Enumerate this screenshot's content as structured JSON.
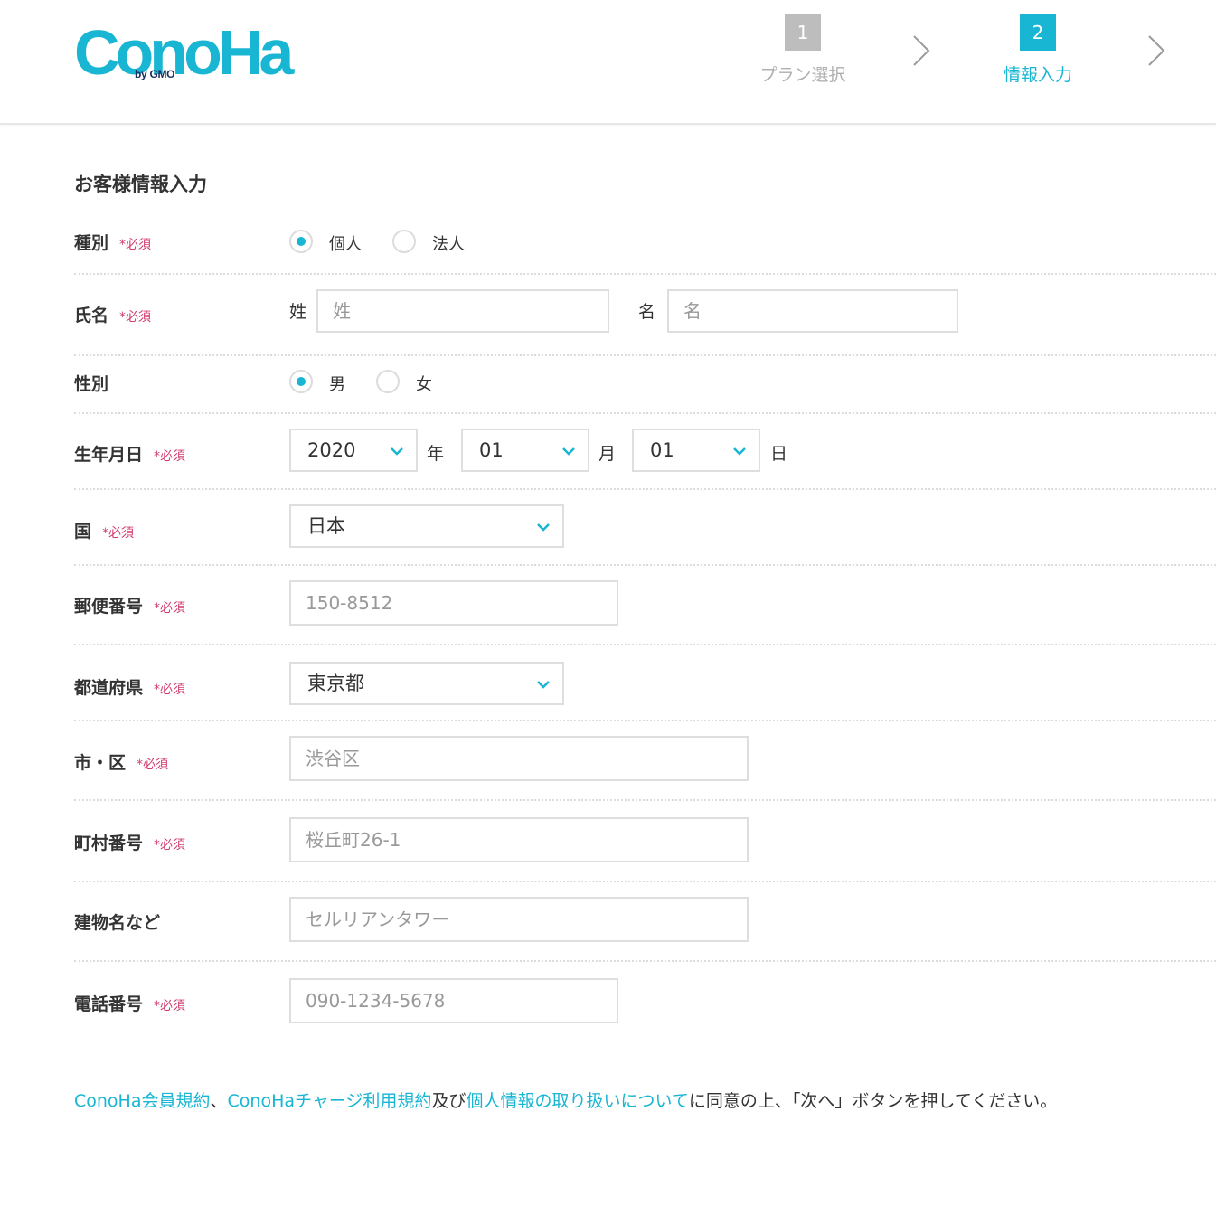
{
  "header": {
    "logo_text": "ConoHa",
    "logo_sub": "by GMO",
    "steps": [
      {
        "number": "1",
        "label": "プラン選択"
      },
      {
        "number": "2",
        "label": "情報入力"
      }
    ]
  },
  "form": {
    "title": "お客様情報入力",
    "required_mark": "*必須",
    "type": {
      "label": "種別",
      "options": [
        "個人",
        "法人"
      ],
      "selected": "個人"
    },
    "name": {
      "label": "氏名",
      "last_label": "姓",
      "last_placeholder": "姓",
      "first_label": "名",
      "first_placeholder": "名"
    },
    "gender": {
      "label": "性別",
      "options": [
        "男",
        "女"
      ],
      "selected": "男"
    },
    "birthdate": {
      "label": "生年月日",
      "year": "2020",
      "year_unit": "年",
      "month": "01",
      "month_unit": "月",
      "day": "01",
      "day_unit": "日"
    },
    "country": {
      "label": "国",
      "value": "日本"
    },
    "postal": {
      "label": "郵便番号",
      "placeholder": "150-8512"
    },
    "prefecture": {
      "label": "都道府県",
      "value": "東京都"
    },
    "city": {
      "label": "市・区",
      "placeholder": "渋谷区"
    },
    "street": {
      "label": "町村番号",
      "placeholder": "桜丘町26-1"
    },
    "building": {
      "label": "建物名など",
      "placeholder": "セルリアンタワー"
    },
    "phone": {
      "label": "電話番号",
      "placeholder": "090-1234-5678"
    }
  },
  "footer": {
    "link1": "ConoHa会員規約",
    "sep": "、",
    "link2": "ConoHaチャージ利用規約",
    "and": "及び",
    "link3": "個人情報の取り扱いについて",
    "tail": "に同意の上、「次へ」ボタンを押してください。"
  },
  "colors": {
    "accent": "#19b6d3",
    "required": "#d13c6d",
    "inactive_step": "#bdbdbd"
  }
}
